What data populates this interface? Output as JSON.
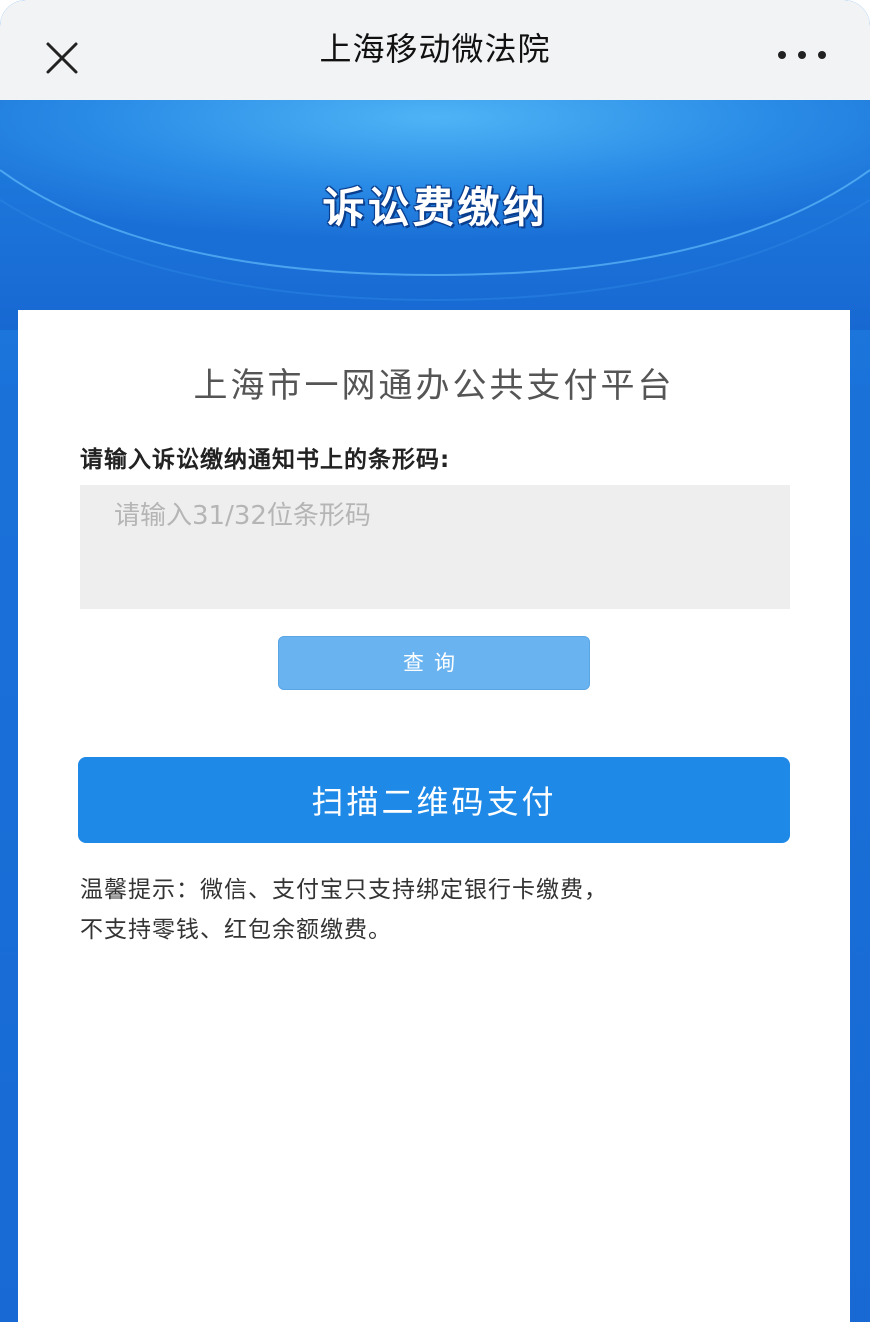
{
  "navbar": {
    "title": "上海移动微法院",
    "close_icon": "close-icon",
    "more_icon": "more-icon"
  },
  "banner": {
    "title": "诉讼费缴纳"
  },
  "main": {
    "platform_title": "上海市一网通办公共支付平台",
    "input_label": "请输入诉讼缴纳通知书上的条形码:",
    "barcode_input": {
      "value": "",
      "placeholder": "请输入31/32位条形码"
    },
    "query_button_label": "查询",
    "scan_button_label": "扫描二维码支付",
    "tip_line1": "温馨提示：微信、支付宝只支持绑定银行卡缴费，",
    "tip_line2": "不支持零钱、红包余额缴费。"
  },
  "colors": {
    "primary_blue": "#1e89e6",
    "light_blue_button": "#69b3f0",
    "banner_blue": "#1a72d9"
  }
}
